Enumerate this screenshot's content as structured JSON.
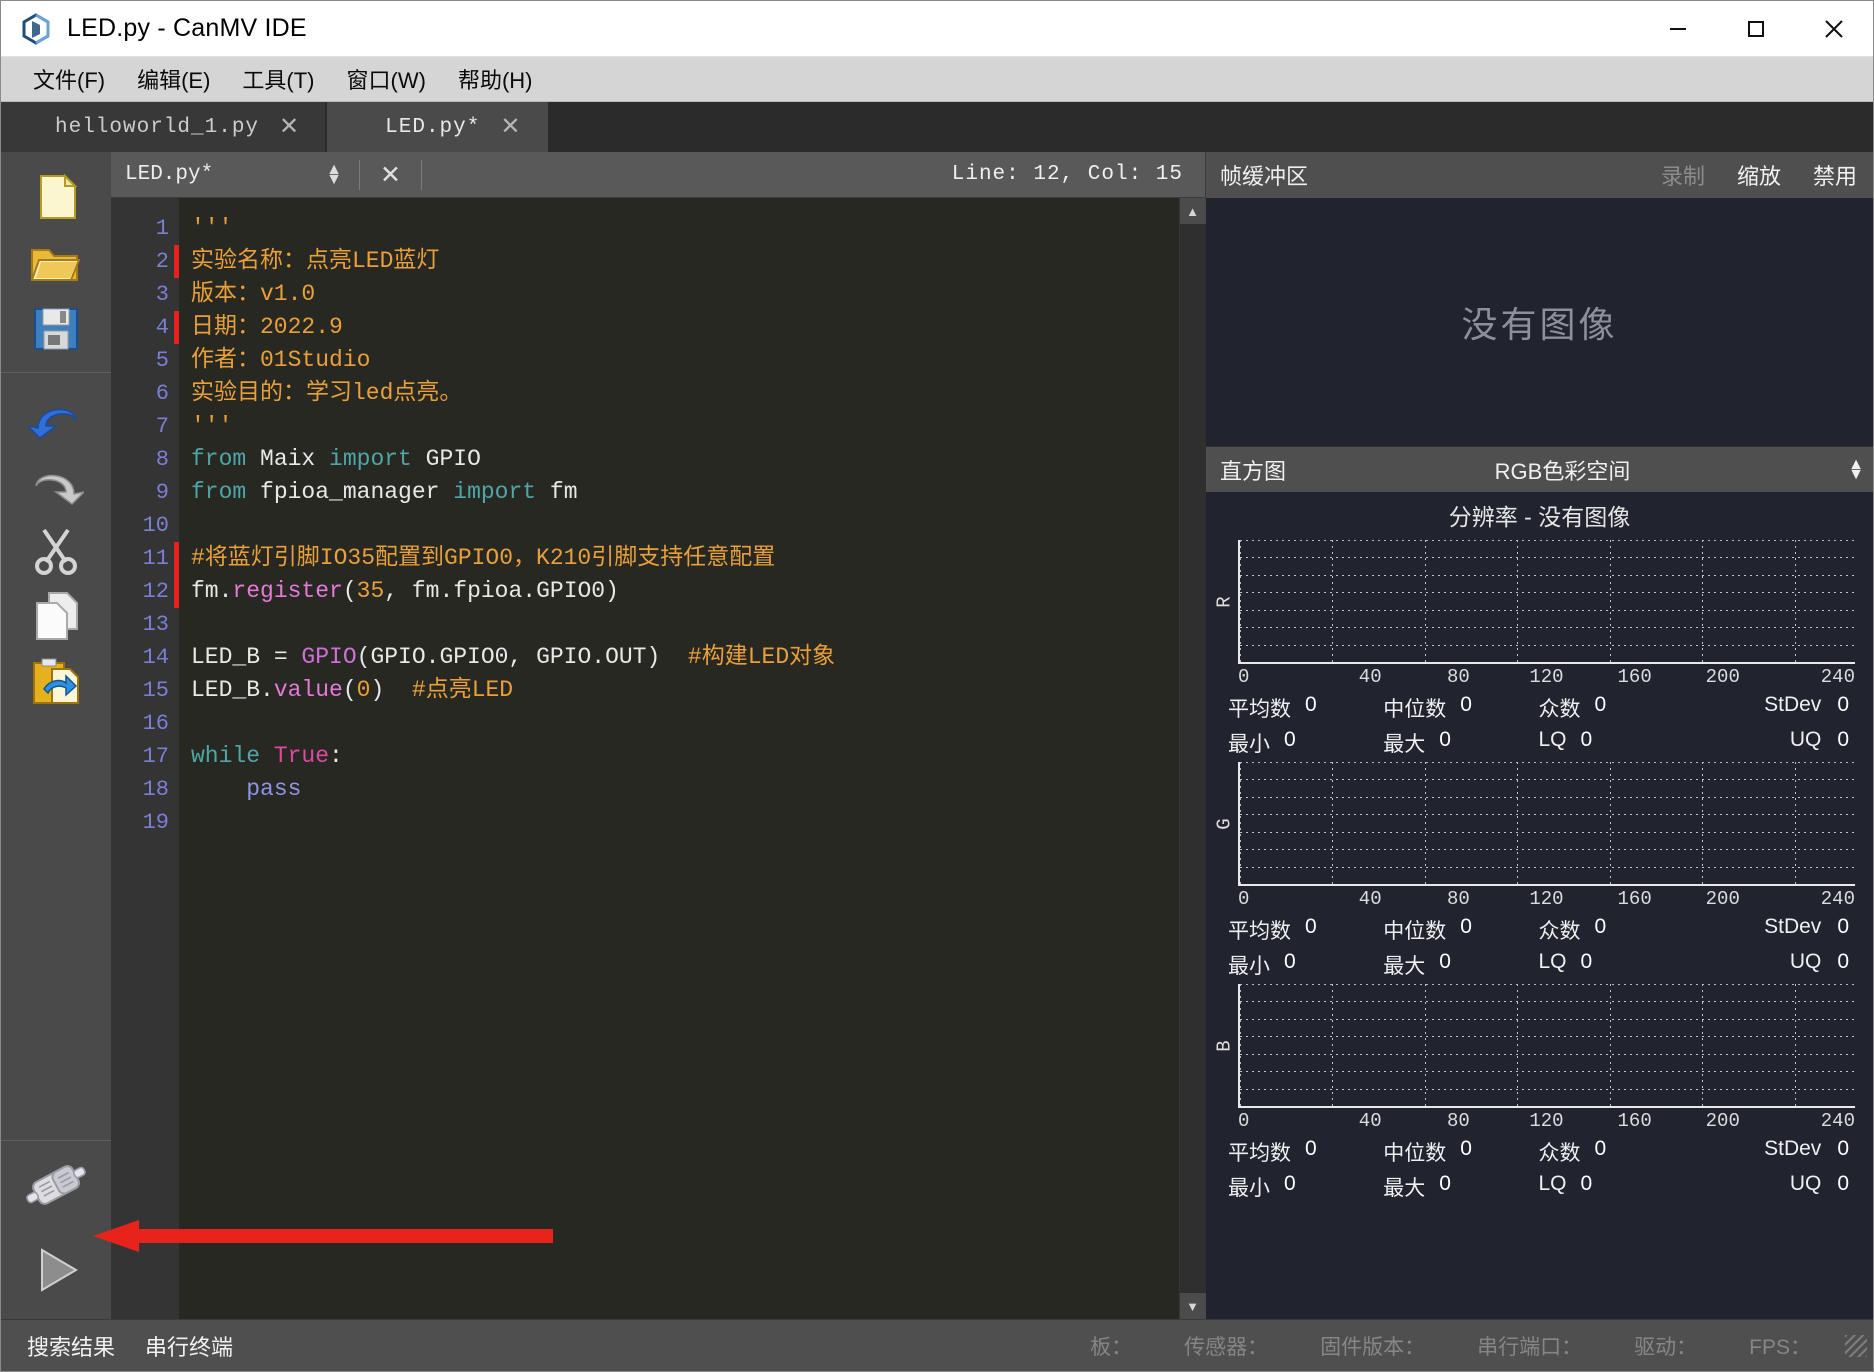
{
  "window": {
    "title": "LED.py - CanMV IDE",
    "logo_icon": "canmv-hex-logo-icon",
    "controls": {
      "minimize": "minimize-icon",
      "maximize": "maximize-icon",
      "close": "close-icon"
    }
  },
  "menubar": [
    {
      "label": "文件(F)",
      "accel": "F"
    },
    {
      "label": "编辑(E)",
      "accel": "E"
    },
    {
      "label": "工具(T)",
      "accel": "T"
    },
    {
      "label": "窗口(W)",
      "accel": "W"
    },
    {
      "label": "帮助(H)",
      "accel": "H"
    }
  ],
  "tabs": [
    {
      "label": "helloworld_1.py",
      "active": false,
      "close": "✕"
    },
    {
      "label": "LED.py*",
      "active": true,
      "close": "✕"
    }
  ],
  "left_toolbar": {
    "groups": [
      [
        {
          "name": "new-file-icon",
          "tooltip": "新建"
        },
        {
          "name": "open-file-icon",
          "tooltip": "打开"
        },
        {
          "name": "save-file-icon",
          "tooltip": "保存"
        }
      ],
      [
        {
          "name": "undo-icon",
          "tooltip": "撤销"
        },
        {
          "name": "redo-icon",
          "tooltip": "重做"
        },
        {
          "name": "cut-icon",
          "tooltip": "剪切"
        },
        {
          "name": "copy-icon",
          "tooltip": "复制"
        },
        {
          "name": "paste-icon",
          "tooltip": "粘贴"
        }
      ]
    ],
    "bottom": [
      {
        "name": "connect-usb-icon",
        "tooltip": "连接"
      },
      {
        "name": "run-play-icon",
        "tooltip": "运行"
      }
    ]
  },
  "editor": {
    "filename": "LED.py*",
    "spinner_icon": "updown-spinner-icon",
    "close_icon": "close-icon",
    "position": "Line: 12,  Col: 15",
    "scroll_up_icon": "chevron-up-icon",
    "scroll_down_icon": "chevron-down-icon",
    "lines": [
      {
        "n": 1,
        "mark": false,
        "fold": false,
        "tokens": [
          {
            "t": "'''",
            "c": "tok-str"
          }
        ]
      },
      {
        "n": 2,
        "mark": true,
        "fold": false,
        "tokens": [
          {
            "t": "实验名称：点亮LED蓝灯",
            "c": "tok-str"
          }
        ]
      },
      {
        "n": 3,
        "mark": false,
        "fold": false,
        "tokens": [
          {
            "t": "版本：v1.0",
            "c": "tok-str"
          }
        ]
      },
      {
        "n": 4,
        "mark": true,
        "fold": false,
        "tokens": [
          {
            "t": "日期：2022.9",
            "c": "tok-str"
          }
        ]
      },
      {
        "n": 5,
        "mark": false,
        "fold": false,
        "tokens": [
          {
            "t": "作者：01Studio",
            "c": "tok-str"
          }
        ]
      },
      {
        "n": 6,
        "mark": false,
        "fold": false,
        "tokens": [
          {
            "t": "实验目的：学习led点亮。",
            "c": "tok-str"
          }
        ]
      },
      {
        "n": 7,
        "mark": false,
        "fold": false,
        "tokens": [
          {
            "t": "'''",
            "c": "tok-str"
          }
        ]
      },
      {
        "n": 8,
        "mark": false,
        "fold": false,
        "tokens": [
          {
            "t": "from",
            "c": "tok-kw"
          },
          {
            "t": " Maix ",
            "c": "tok-plain"
          },
          {
            "t": "import",
            "c": "tok-kw"
          },
          {
            "t": " GPIO",
            "c": "tok-plain"
          }
        ]
      },
      {
        "n": 9,
        "mark": false,
        "fold": false,
        "tokens": [
          {
            "t": "from",
            "c": "tok-kw"
          },
          {
            "t": " fpioa_manager ",
            "c": "tok-plain"
          },
          {
            "t": "import",
            "c": "tok-kw"
          },
          {
            "t": " fm",
            "c": "tok-plain"
          }
        ]
      },
      {
        "n": 10,
        "mark": false,
        "fold": false,
        "tokens": []
      },
      {
        "n": 11,
        "mark": true,
        "fold": false,
        "tokens": [
          {
            "t": "#将蓝灯引脚IO35配置到GPIO0，K210引脚支持任意配置",
            "c": "tok-comment"
          }
        ]
      },
      {
        "n": 12,
        "mark": true,
        "fold": false,
        "tokens": [
          {
            "t": "fm.",
            "c": "tok-plain"
          },
          {
            "t": "register",
            "c": "tok-fn"
          },
          {
            "t": "(",
            "c": "tok-plain"
          },
          {
            "t": "35",
            "c": "tok-num"
          },
          {
            "t": ", fm.fpioa.GPIO0)",
            "c": "tok-plain"
          }
        ]
      },
      {
        "n": 13,
        "mark": false,
        "fold": false,
        "tokens": []
      },
      {
        "n": 14,
        "mark": false,
        "fold": false,
        "tokens": [
          {
            "t": "LED_B = ",
            "c": "tok-plain"
          },
          {
            "t": "GPIO",
            "c": "tok-type"
          },
          {
            "t": "(GPIO.GPIO0, GPIO.OUT)  ",
            "c": "tok-plain"
          },
          {
            "t": "#构建LED对象",
            "c": "tok-comment"
          }
        ]
      },
      {
        "n": 15,
        "mark": false,
        "fold": false,
        "tokens": [
          {
            "t": "LED_B.",
            "c": "tok-plain"
          },
          {
            "t": "value",
            "c": "tok-fn"
          },
          {
            "t": "(",
            "c": "tok-plain"
          },
          {
            "t": "0",
            "c": "tok-num"
          },
          {
            "t": ")  ",
            "c": "tok-plain"
          },
          {
            "t": "#点亮LED",
            "c": "tok-comment"
          }
        ]
      },
      {
        "n": 16,
        "mark": false,
        "fold": false,
        "tokens": []
      },
      {
        "n": 17,
        "mark": false,
        "fold": true,
        "tokens": [
          {
            "t": "while",
            "c": "tok-kw"
          },
          {
            "t": " ",
            "c": "tok-plain"
          },
          {
            "t": "True",
            "c": "tok-kw2"
          },
          {
            "t": ":",
            "c": "tok-plain"
          }
        ]
      },
      {
        "n": 18,
        "mark": false,
        "fold": false,
        "tokens": [
          {
            "t": "    ",
            "c": "tok-plain"
          },
          {
            "t": "pass",
            "c": "tok-var"
          }
        ]
      },
      {
        "n": 19,
        "mark": false,
        "fold": false,
        "tokens": []
      }
    ]
  },
  "framebuffer": {
    "title": "帧缓冲区",
    "actions": [
      {
        "label": "录制",
        "disabled": true
      },
      {
        "label": "缩放",
        "disabled": false
      },
      {
        "label": "禁用",
        "disabled": false
      }
    ],
    "no_image": "没有图像"
  },
  "histogram": {
    "title": "直方图",
    "colorspace": "RGB色彩空间",
    "spinner_icon": "updown-spinner-icon",
    "resolution": "分辨率 - 没有图像",
    "stat_labels": {
      "mean": "平均数",
      "median": "中位数",
      "mode": "众数",
      "stdev": "StDev",
      "min": "最小",
      "max": "最大",
      "lq": "LQ",
      "uq": "UQ"
    },
    "channels": [
      {
        "name": "R",
        "values": {
          "mean": "0",
          "median": "0",
          "mode": "0",
          "stdev": "0",
          "min": "0",
          "max": "0",
          "lq": "0",
          "uq": "0"
        }
      },
      {
        "name": "G",
        "values": {
          "mean": "0",
          "median": "0",
          "mode": "0",
          "stdev": "0",
          "min": "0",
          "max": "0",
          "lq": "0",
          "uq": "0"
        }
      },
      {
        "name": "B",
        "values": {
          "mean": "0",
          "median": "0",
          "mode": "0",
          "stdev": "0",
          "min": "0",
          "max": "0",
          "lq": "0",
          "uq": "0"
        }
      }
    ]
  },
  "chart_data": {
    "type": "bar",
    "title": "分辨率 - 没有图像",
    "xlabel": "",
    "ylabel": "",
    "grid": true,
    "legend": "none",
    "xticks": [
      "0",
      "40",
      "80",
      "120",
      "160",
      "200",
      "240"
    ],
    "xlim": [
      0,
      255
    ],
    "series": [
      {
        "name": "R",
        "values": []
      },
      {
        "name": "G",
        "values": []
      },
      {
        "name": "B",
        "values": []
      }
    ]
  },
  "bottombar": {
    "tabs": [
      {
        "label": "搜索结果",
        "active": true
      },
      {
        "label": "串行终端",
        "active": false
      }
    ],
    "status": [
      {
        "label": "板："
      },
      {
        "label": "传感器："
      },
      {
        "label": "固件版本："
      },
      {
        "label": "串行端口："
      },
      {
        "label": "驱动："
      },
      {
        "label": "FPS："
      }
    ],
    "grip_icon": "resize-grip-icon"
  },
  "annotation": {
    "arrow_icon": "red-arrow-left-icon",
    "color": "#e8231c"
  }
}
